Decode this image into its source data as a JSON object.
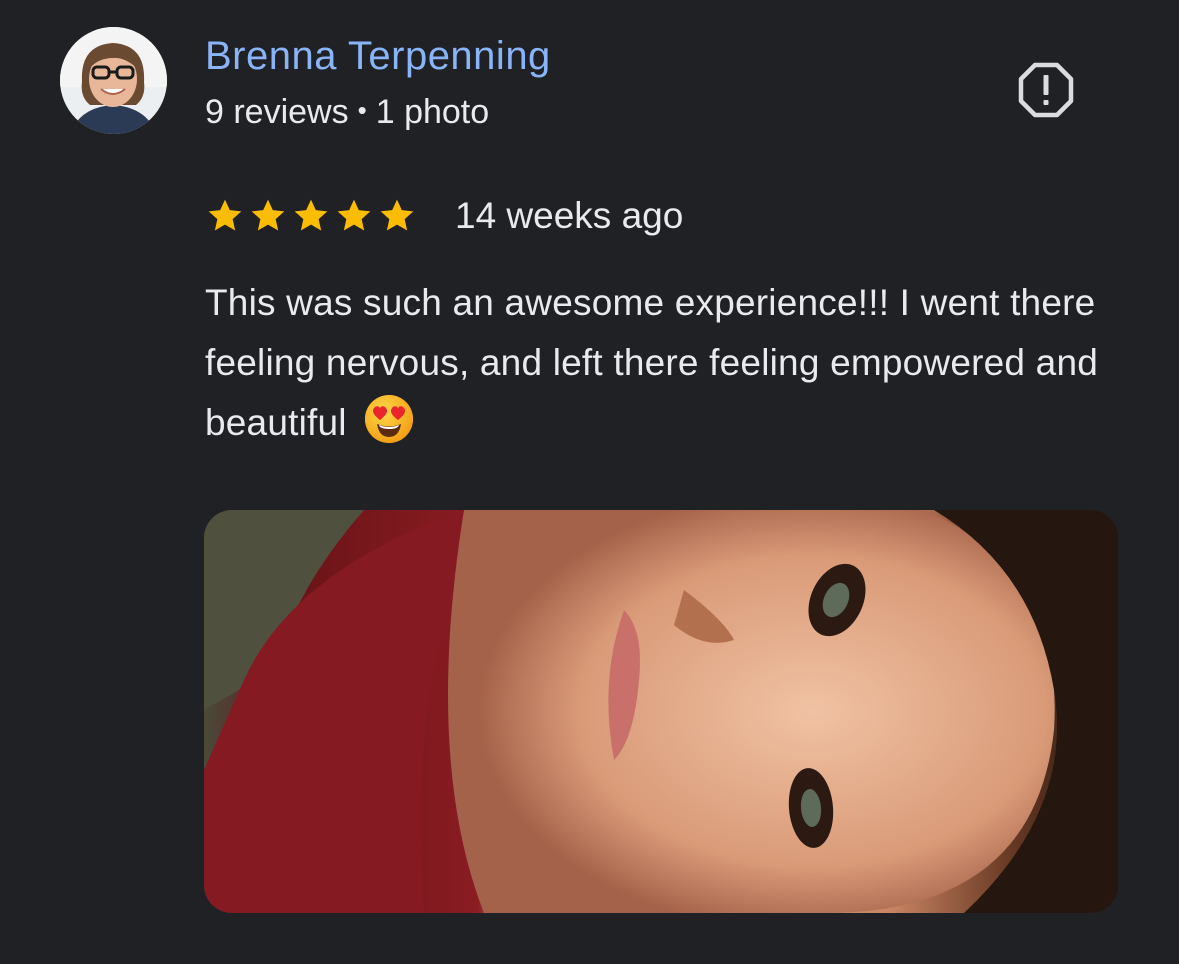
{
  "reviewer": {
    "name": "Brenna Terpenning",
    "reviews_count": "9 reviews",
    "separator": "•",
    "photos_count": "1 photo",
    "avatar_icon": "reviewer-avatar-photo"
  },
  "review": {
    "rating": 5,
    "max_rating": 5,
    "star_color": "#fbbc04",
    "time_ago": "14 weeks ago",
    "text": "This was such an awesome experience!!! I went there feeling nervous, and left there feeling empowered and beautiful",
    "emoji": "smiling-face-with-heart-eyes",
    "photo": "review-photo"
  },
  "actions": {
    "report_icon": "report-icon"
  },
  "colors": {
    "background": "#202124",
    "name": "#8ab4f8",
    "text": "#e8eaed",
    "icon": "#dadce0"
  }
}
